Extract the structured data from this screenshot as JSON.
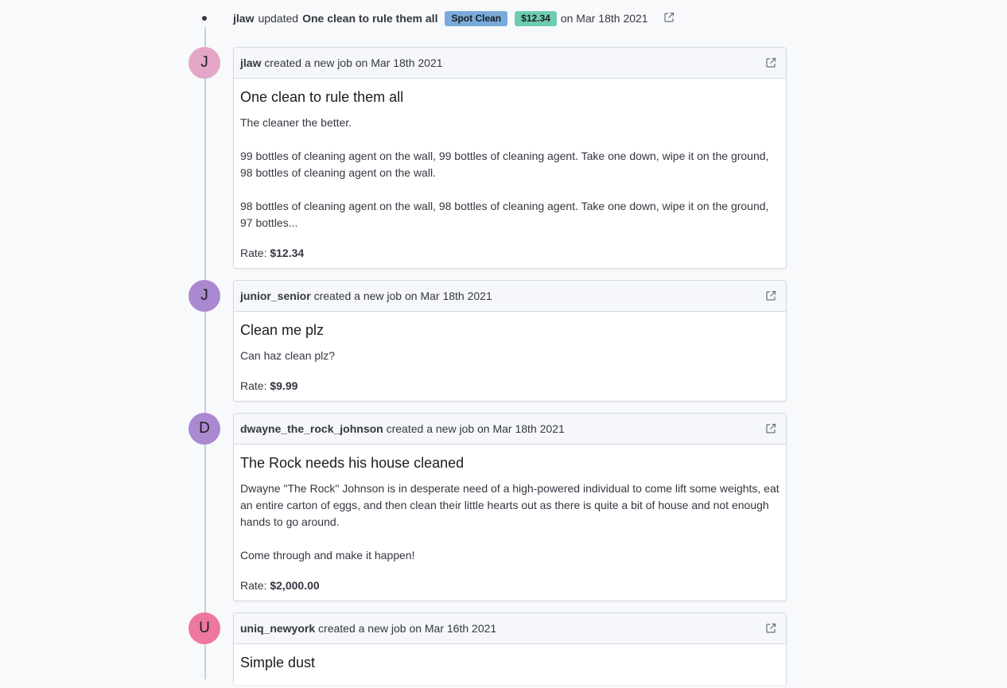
{
  "update": {
    "user": "jlaw",
    "verb": "updated",
    "job_title": "One clean to rule them all",
    "badges": [
      {
        "label": "Spot Clean",
        "color": "#79aad9"
      },
      {
        "label": "$12.34",
        "color": "#6dccb1"
      }
    ],
    "date": "on Mar 18th 2021"
  },
  "entries": [
    {
      "initial": "J",
      "avatar_color": "#e4a6c7",
      "user": "jlaw",
      "action": "created a new job on Mar 18th 2021",
      "title": "One clean to rule them all",
      "paragraphs": [
        "The cleaner the better.",
        "99 bottles of cleaning agent on the wall, 99 bottles of cleaning agent. Take one down, wipe it on the ground, 98 bottles of cleaning agent on the wall.",
        "98 bottles of cleaning agent on the wall, 98 bottles of cleaning agent. Take one down, wipe it on the ground, 97 bottles..."
      ],
      "rate_label": "Rate:",
      "rate": "$12.34"
    },
    {
      "initial": "J",
      "avatar_color": "#aa89d1",
      "user": "junior_senior",
      "action": "created a new job on Mar 18th 2021",
      "title": "Clean me plz",
      "paragraphs": [
        "Can haz clean plz?"
      ],
      "rate_label": "Rate:",
      "rate": "$9.99"
    },
    {
      "initial": "D",
      "avatar_color": "#aa89d1",
      "user": "dwayne_the_rock_johnson",
      "action": "created a new job on Mar 18th 2021",
      "title": "The Rock needs his house cleaned",
      "paragraphs": [
        "Dwayne \"The Rock\" Johnson is in desperate need of a high-powered individual to come lift some weights, eat an entire carton of eggs, and then clean their little hearts out as there is quite a bit of house and not enough hands to go around.",
        "Come through and make it happen!"
      ],
      "rate_label": "Rate:",
      "rate": "$2,000.00"
    },
    {
      "initial": "U",
      "avatar_color": "#ee789d",
      "user": "uniq_newyork",
      "action": "created a new job on Mar 16th 2021",
      "title": "Simple dust",
      "paragraphs": [],
      "rate_label": "",
      "rate": ""
    }
  ]
}
